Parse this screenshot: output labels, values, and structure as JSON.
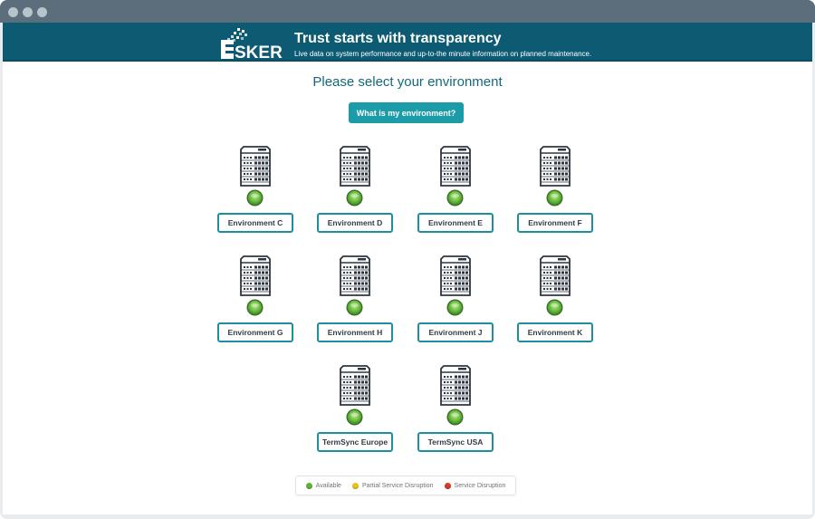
{
  "banner": {
    "logo_text": "ESKER",
    "title": "Trust starts with transparency",
    "subtitle": "Live data on system performance and up-to-the minute information on planned maintenance."
  },
  "main": {
    "heading": "Please select your environment",
    "help_button": "What is my environment?",
    "environments": [
      {
        "label": "Environment C",
        "status": "available"
      },
      {
        "label": "Environment D",
        "status": "available"
      },
      {
        "label": "Environment E",
        "status": "available"
      },
      {
        "label": "Environment F",
        "status": "available"
      },
      {
        "label": "Environment G",
        "status": "available"
      },
      {
        "label": "Environment H",
        "status": "available"
      },
      {
        "label": "Environment J",
        "status": "available"
      },
      {
        "label": "Environment K",
        "status": "available"
      },
      {
        "label": "TermSync Europe",
        "status": "available"
      },
      {
        "label": "TermSync USA",
        "status": "available"
      }
    ]
  },
  "legend": {
    "items": [
      {
        "label": "Available",
        "color": "#5db33a"
      },
      {
        "label": "Partial Service Disruption",
        "color": "#e9c316"
      },
      {
        "label": "Service Disruption",
        "color": "#d93a2b"
      }
    ]
  },
  "colors": {
    "banner": "#0c5b73",
    "accent": "#1c9ca9",
    "status_available": "#5db33a"
  },
  "icons": {
    "server": "server-rack-icon",
    "status": "status-indicator-icon"
  }
}
